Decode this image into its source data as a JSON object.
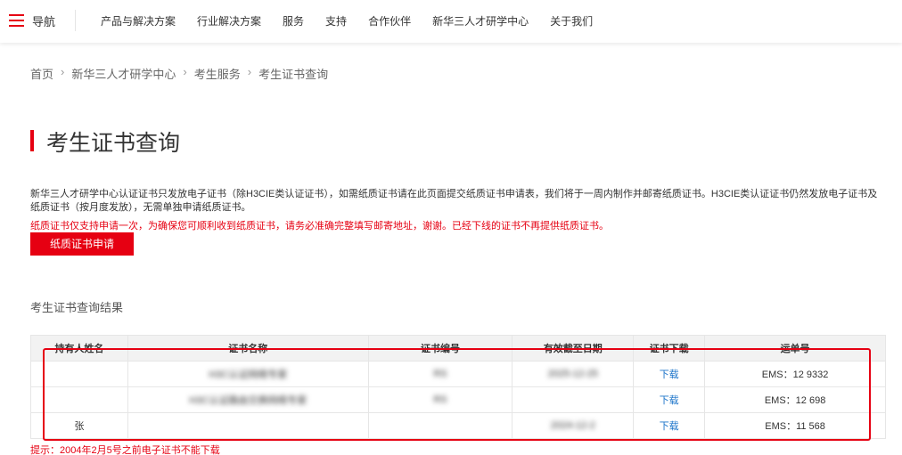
{
  "nav": {
    "label": "导航",
    "items": [
      "产品与解决方案",
      "行业解决方案",
      "服务",
      "支持",
      "合作伙伴",
      "新华三人才研学中心",
      "关于我们"
    ]
  },
  "breadcrumb": [
    "首页",
    "新华三人才研学中心",
    "考生服务",
    "考生证书查询"
  ],
  "page": {
    "title": "考生证书查询",
    "description": "新华三人才研学中心认证证书只发放电子证书（除H3CIE类认证证书），如需纸质证书请在此页面提交纸质证书申请表，我们将于一周内制作并邮寄纸质证书。H3CIE类认证证书仍然发放电子证书及纸质证书（按月度发放），无需单独申请纸质证书。",
    "notice": "纸质证书仅支持申请一次，为确保您可顺利收到纸质证书，请务必准确完整填写邮寄地址，谢谢。已经下线的证书不再提供纸质证书。",
    "apply_button": "纸质证书申请",
    "results_title": "考生证书查询结果",
    "tip": "提示：2004年2月5号之前电子证书不能下载"
  },
  "table": {
    "headers": [
      "持有人姓名",
      "证书名称",
      "证书编号",
      "有效截至日期",
      "证书下载",
      "运单号"
    ],
    "rows": [
      [
        "",
        "H3C认证网络专家",
        "RS",
        "2025-12-25",
        "下载",
        "EMS：12 9332"
      ],
      [
        "",
        "H3C认证路由交换网络专家",
        "RS",
        "",
        "下载",
        "EMS：12 698"
      ],
      [
        "张",
        "",
        "",
        "2024-12-2",
        "下载",
        "EMS：11 568"
      ]
    ]
  },
  "colors": {
    "brand": "#e60012",
    "link": "#1a73c9"
  }
}
